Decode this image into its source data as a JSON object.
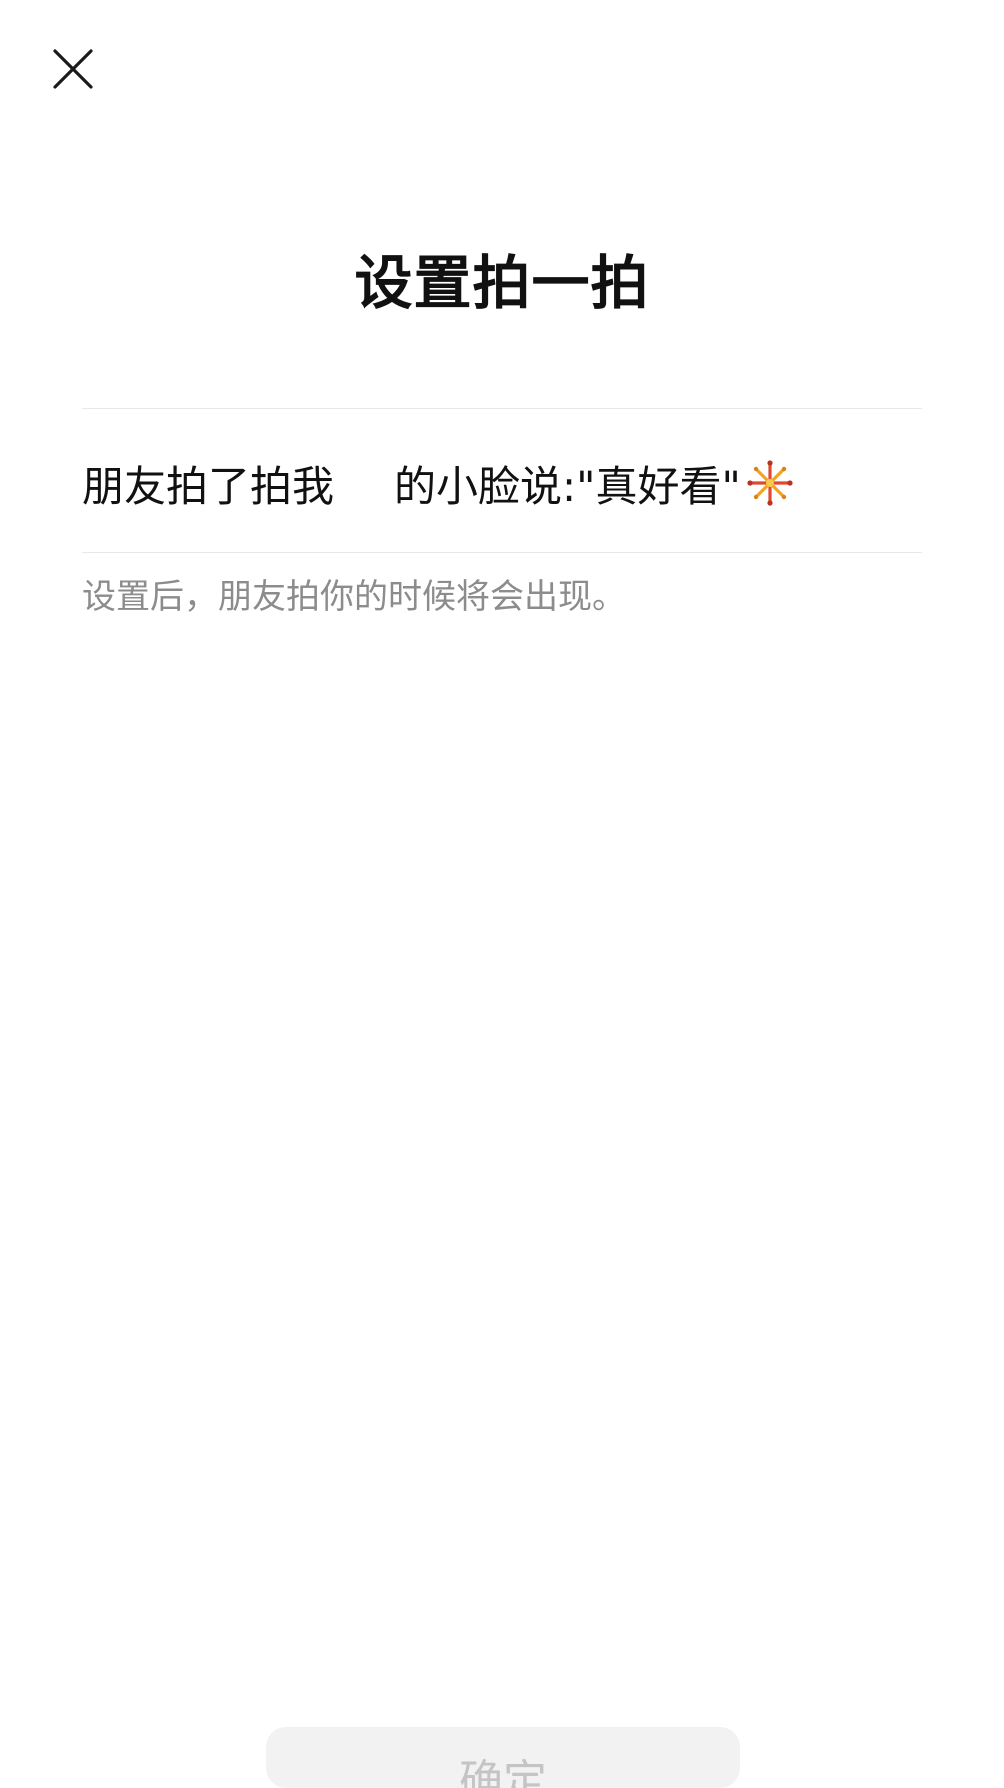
{
  "header": {
    "close_icon": "close-icon"
  },
  "page": {
    "title": "设置拍一拍"
  },
  "pat_setting": {
    "prefix": "朋友拍了拍我",
    "suffix": "的小脸说:\"真好看\"",
    "emoji_icon": "fireworks-icon"
  },
  "hint": {
    "text": "设置后，朋友拍你的时候将会出现。"
  },
  "footer": {
    "confirm_label": "确定"
  },
  "colors": {
    "title": "#111111",
    "hint": "#8c8c8c",
    "divider": "#e8e8e8",
    "button_bg": "#f2f2f2",
    "button_text_disabled": "#c4c4c4"
  }
}
